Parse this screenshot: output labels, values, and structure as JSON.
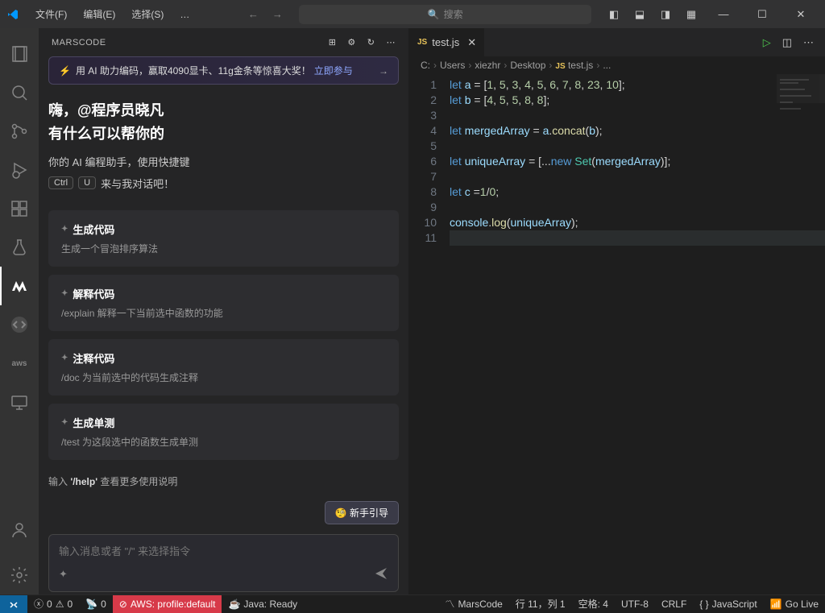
{
  "menubar": {
    "file": "文件(F)",
    "edit": "编辑(E)",
    "select": "选择(S)",
    "more": "…"
  },
  "search_placeholder": "搜索",
  "sidepanel": {
    "title": "MARSCODE",
    "banner": {
      "text": "用 AI 助力编码，赢取4090显卡、11g金条等惊喜大奖！",
      "link": "立即参与"
    },
    "greeting_line1": "嗨，@程序员晓凡",
    "greeting_line2": "有什么可以帮你的",
    "subtitle": "你的 AI 编程助手，使用快捷键",
    "kbd1": "Ctrl",
    "kbd2": "U",
    "kbd_tail": "来与我对话吧！",
    "cards": [
      {
        "title": "生成代码",
        "desc": "生成一个冒泡排序算法"
      },
      {
        "title": "解释代码",
        "desc": "/explain 解释一下当前选中函数的功能"
      },
      {
        "title": "注释代码",
        "desc": "/doc 为当前选中的代码生成注释"
      },
      {
        "title": "生成单测",
        "desc": "/test 为这段选中的函数生成单测"
      }
    ],
    "help_hint_prefix": "输入 ",
    "help_hint_cmd": "'/help'",
    "help_hint_suffix": " 查看更多使用说明",
    "guide_btn": "🧐 新手引导",
    "input_placeholder": "输入消息或者 \"/\" 来选择指令"
  },
  "tab": {
    "file": "test.js"
  },
  "breadcrumb": [
    "C:",
    "Users",
    "xiezhr",
    "Desktop",
    "test.js",
    "..."
  ],
  "code": {
    "line_count": 11,
    "lines": [
      {
        "n": 1,
        "html": "<span class='k'>let</span> <span class='v'>a</span> <span class='p'>= [</span><span class='n'>1</span><span class='p'>, </span><span class='n'>5</span><span class='p'>, </span><span class='n'>3</span><span class='p'>, </span><span class='n'>4</span><span class='p'>, </span><span class='n'>5</span><span class='p'>, </span><span class='n'>6</span><span class='p'>, </span><span class='n'>7</span><span class='p'>, </span><span class='n'>8</span><span class='p'>, </span><span class='n'>23</span><span class='p'>, </span><span class='n'>10</span><span class='p'>];</span>"
      },
      {
        "n": 2,
        "html": "<span class='k'>let</span> <span class='v'>b</span> <span class='p'>= [</span><span class='n'>4</span><span class='p'>, </span><span class='n'>5</span><span class='p'>, </span><span class='n'>5</span><span class='p'>, </span><span class='n'>8</span><span class='p'>, </span><span class='n'>8</span><span class='p'>];</span>"
      },
      {
        "n": 3,
        "html": ""
      },
      {
        "n": 4,
        "html": "<span class='k'>let</span> <span class='v'>mergedArray</span> <span class='p'>= </span><span class='v'>a</span><span class='p'>.</span><span class='fn'>concat</span><span class='p'>(</span><span class='v'>b</span><span class='p'>);</span>"
      },
      {
        "n": 5,
        "html": ""
      },
      {
        "n": 6,
        "html": "<span class='k'>let</span> <span class='v'>uniqueArray</span> <span class='p'>= [...</span><span class='k'>new</span> <span class='cls'>Set</span><span class='p'>(</span><span class='v'>mergedArray</span><span class='p'>)];</span>"
      },
      {
        "n": 7,
        "html": ""
      },
      {
        "n": 8,
        "html": "<span class='k'>let</span> <span class='v'>c</span> <span class='p'>=</span><span class='n'>1</span><span class='p'>/</span><span class='n'>0</span><span class='p'>;</span>"
      },
      {
        "n": 9,
        "html": ""
      },
      {
        "n": 10,
        "html": "<span class='v'>console</span><span class='p'>.</span><span class='fn'>log</span><span class='p'>(</span><span class='v'>uniqueArray</span><span class='p'>);</span>"
      },
      {
        "n": 11,
        "html": "",
        "hl": true
      }
    ]
  },
  "statusbar": {
    "errors": "0",
    "warnings": "0",
    "radio": "0",
    "aws": "AWS: profile:default",
    "java": "Java: Ready",
    "marscode": "MarsCode",
    "cursor": "行 11，列 1",
    "spaces": "空格: 4",
    "encoding": "UTF-8",
    "eol": "CRLF",
    "lang": "JavaScript",
    "golive": "Go Live"
  }
}
